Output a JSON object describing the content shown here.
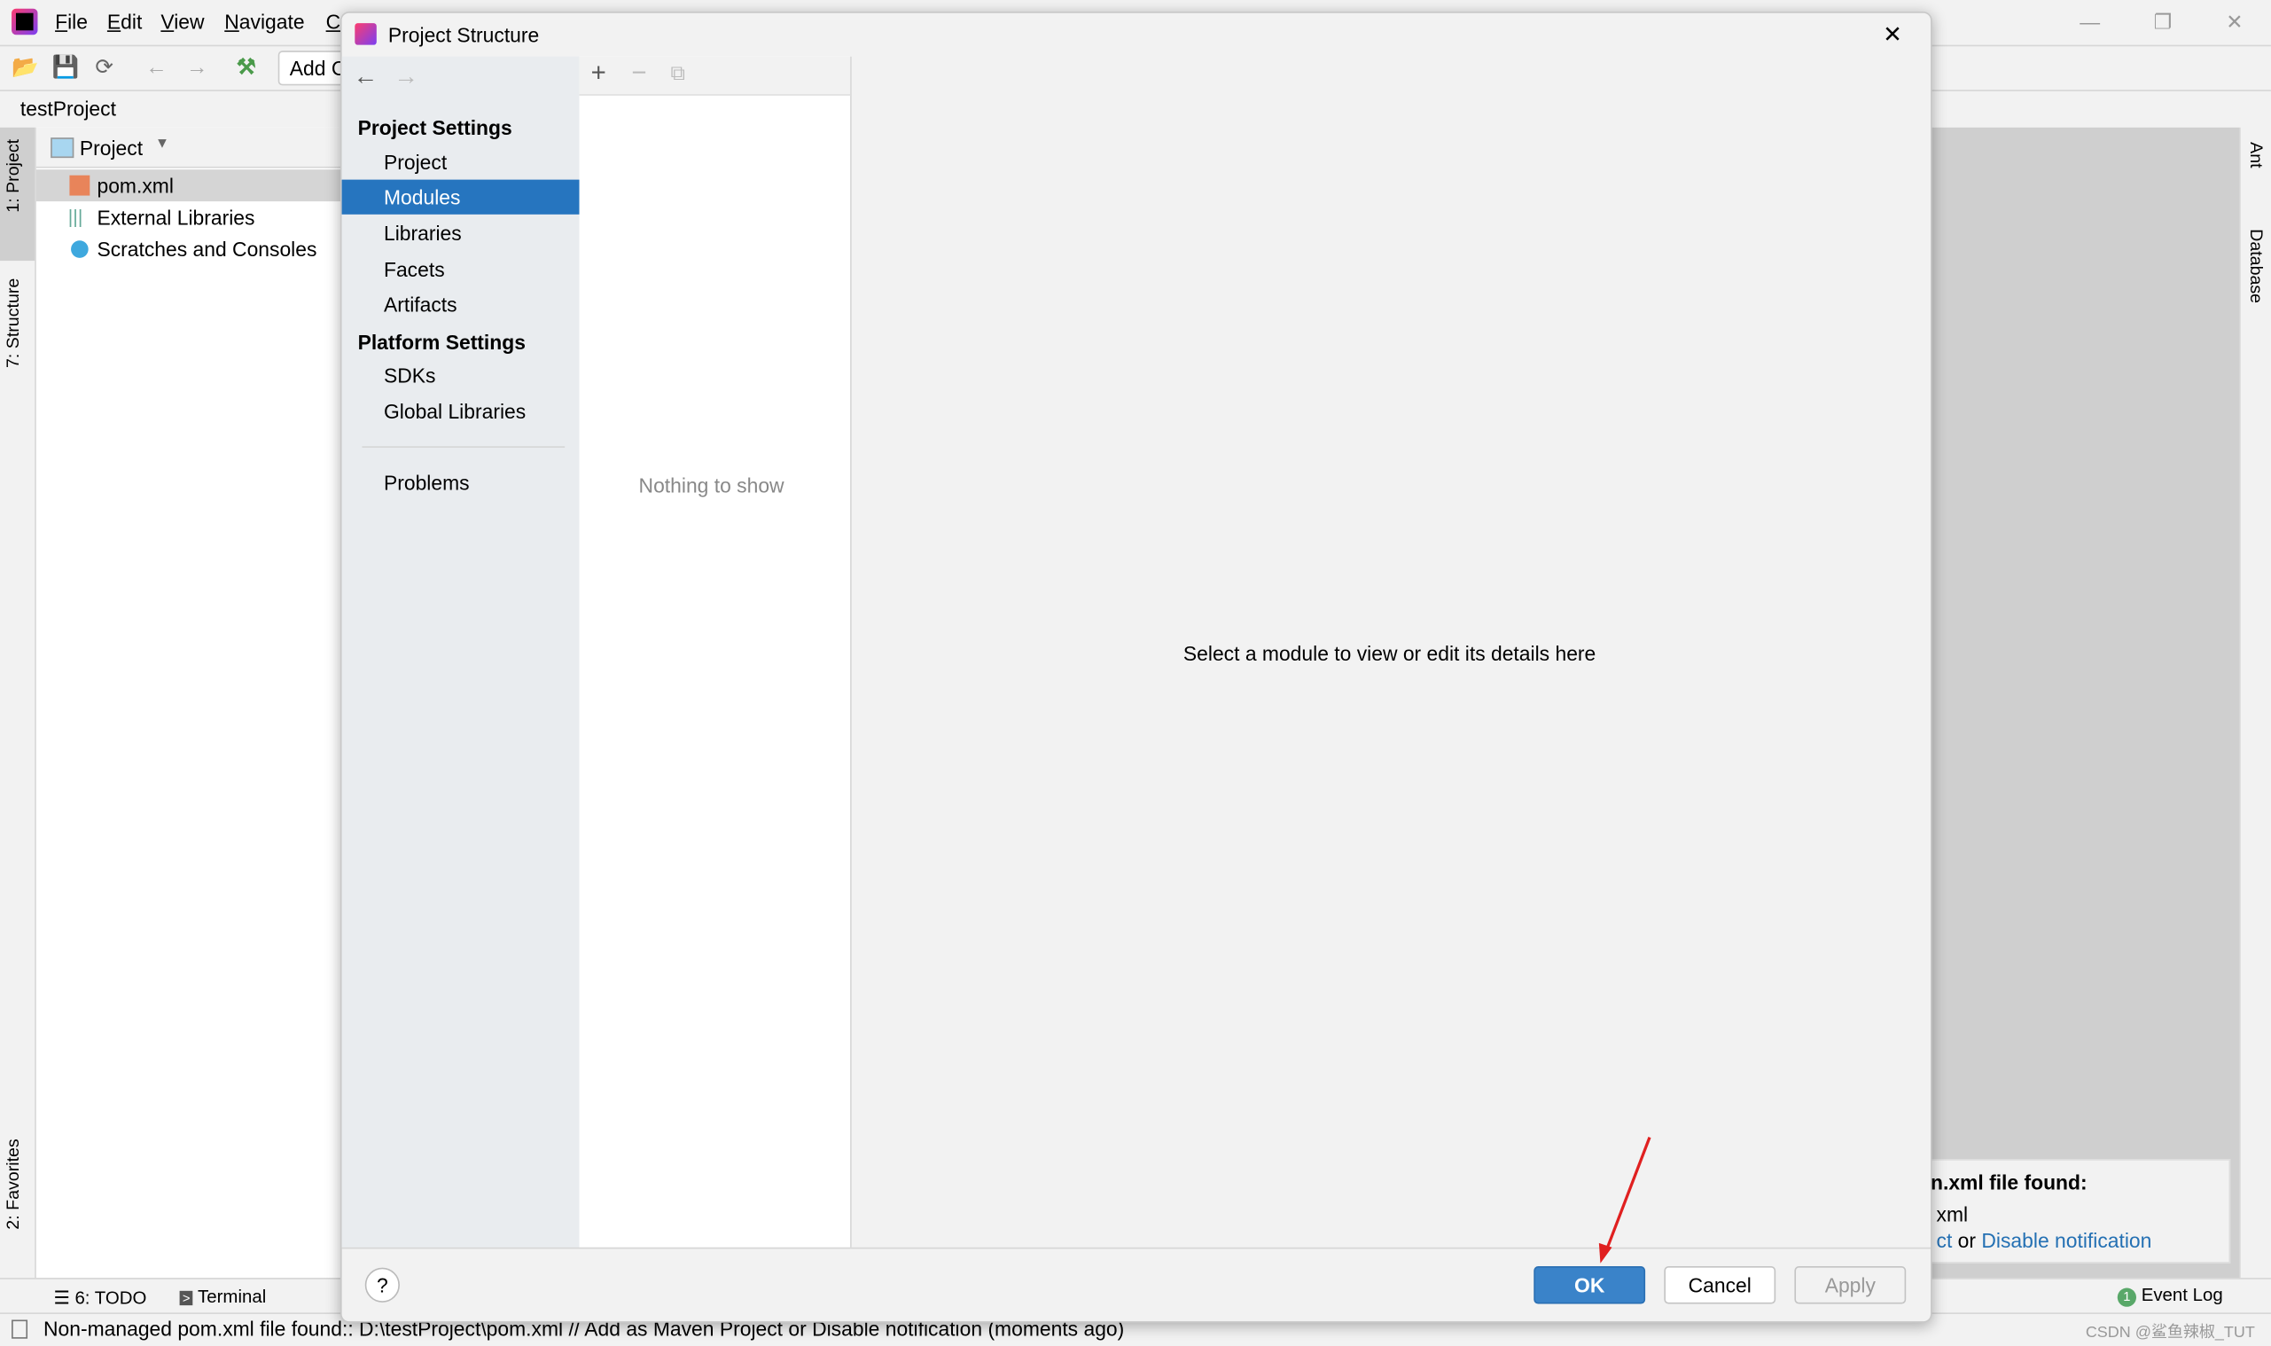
{
  "ide": {
    "menu": [
      "File",
      "Edit",
      "View",
      "Navigate",
      "C"
    ],
    "toolbar_run_config": "Add C",
    "breadcrumb": "testProject",
    "left_tabs": [
      "1: Project",
      "7: Structure",
      "2: Favorites"
    ],
    "right_tabs": [
      "Ant",
      "Database"
    ],
    "project_panel": {
      "view_selector": "Project",
      "tree": [
        {
          "label": "pom.xml",
          "icon": "maven-file-icon",
          "selected": true
        },
        {
          "label": "External Libraries",
          "icon": "libraries-icon"
        },
        {
          "label": "Scratches and Consoles",
          "icon": "scratches-icon"
        }
      ]
    },
    "notification": {
      "title": "n.xml file found:",
      "line": "xml",
      "link_partial": "ct",
      "or": "or",
      "disable_link": "Disable notification"
    },
    "bottom_tabs": [
      "6: TODO",
      "Terminal"
    ],
    "event_log": {
      "count": "1",
      "label": "Event Log"
    },
    "status_message": "Non-managed pom.xml file found:: D:\\testProject\\pom.xml // Add as Maven Project or Disable notification (moments ago)",
    "watermark": "CSDN @鲨鱼辣椒_TUT"
  },
  "dialog": {
    "title": "Project Structure",
    "project_settings_header": "Project Settings",
    "project_settings_items": [
      "Project",
      "Modules",
      "Libraries",
      "Facets",
      "Artifacts"
    ],
    "platform_settings_header": "Platform Settings",
    "platform_settings_items": [
      "SDKs",
      "Global Libraries"
    ],
    "problems": "Problems",
    "selected_item": "Modules",
    "empty_list": "Nothing to show",
    "detail_placeholder": "Select a module to view or edit its details here",
    "buttons": {
      "ok": "OK",
      "cancel": "Cancel",
      "apply": "Apply",
      "help": "?"
    },
    "accent": "#2675bf"
  }
}
